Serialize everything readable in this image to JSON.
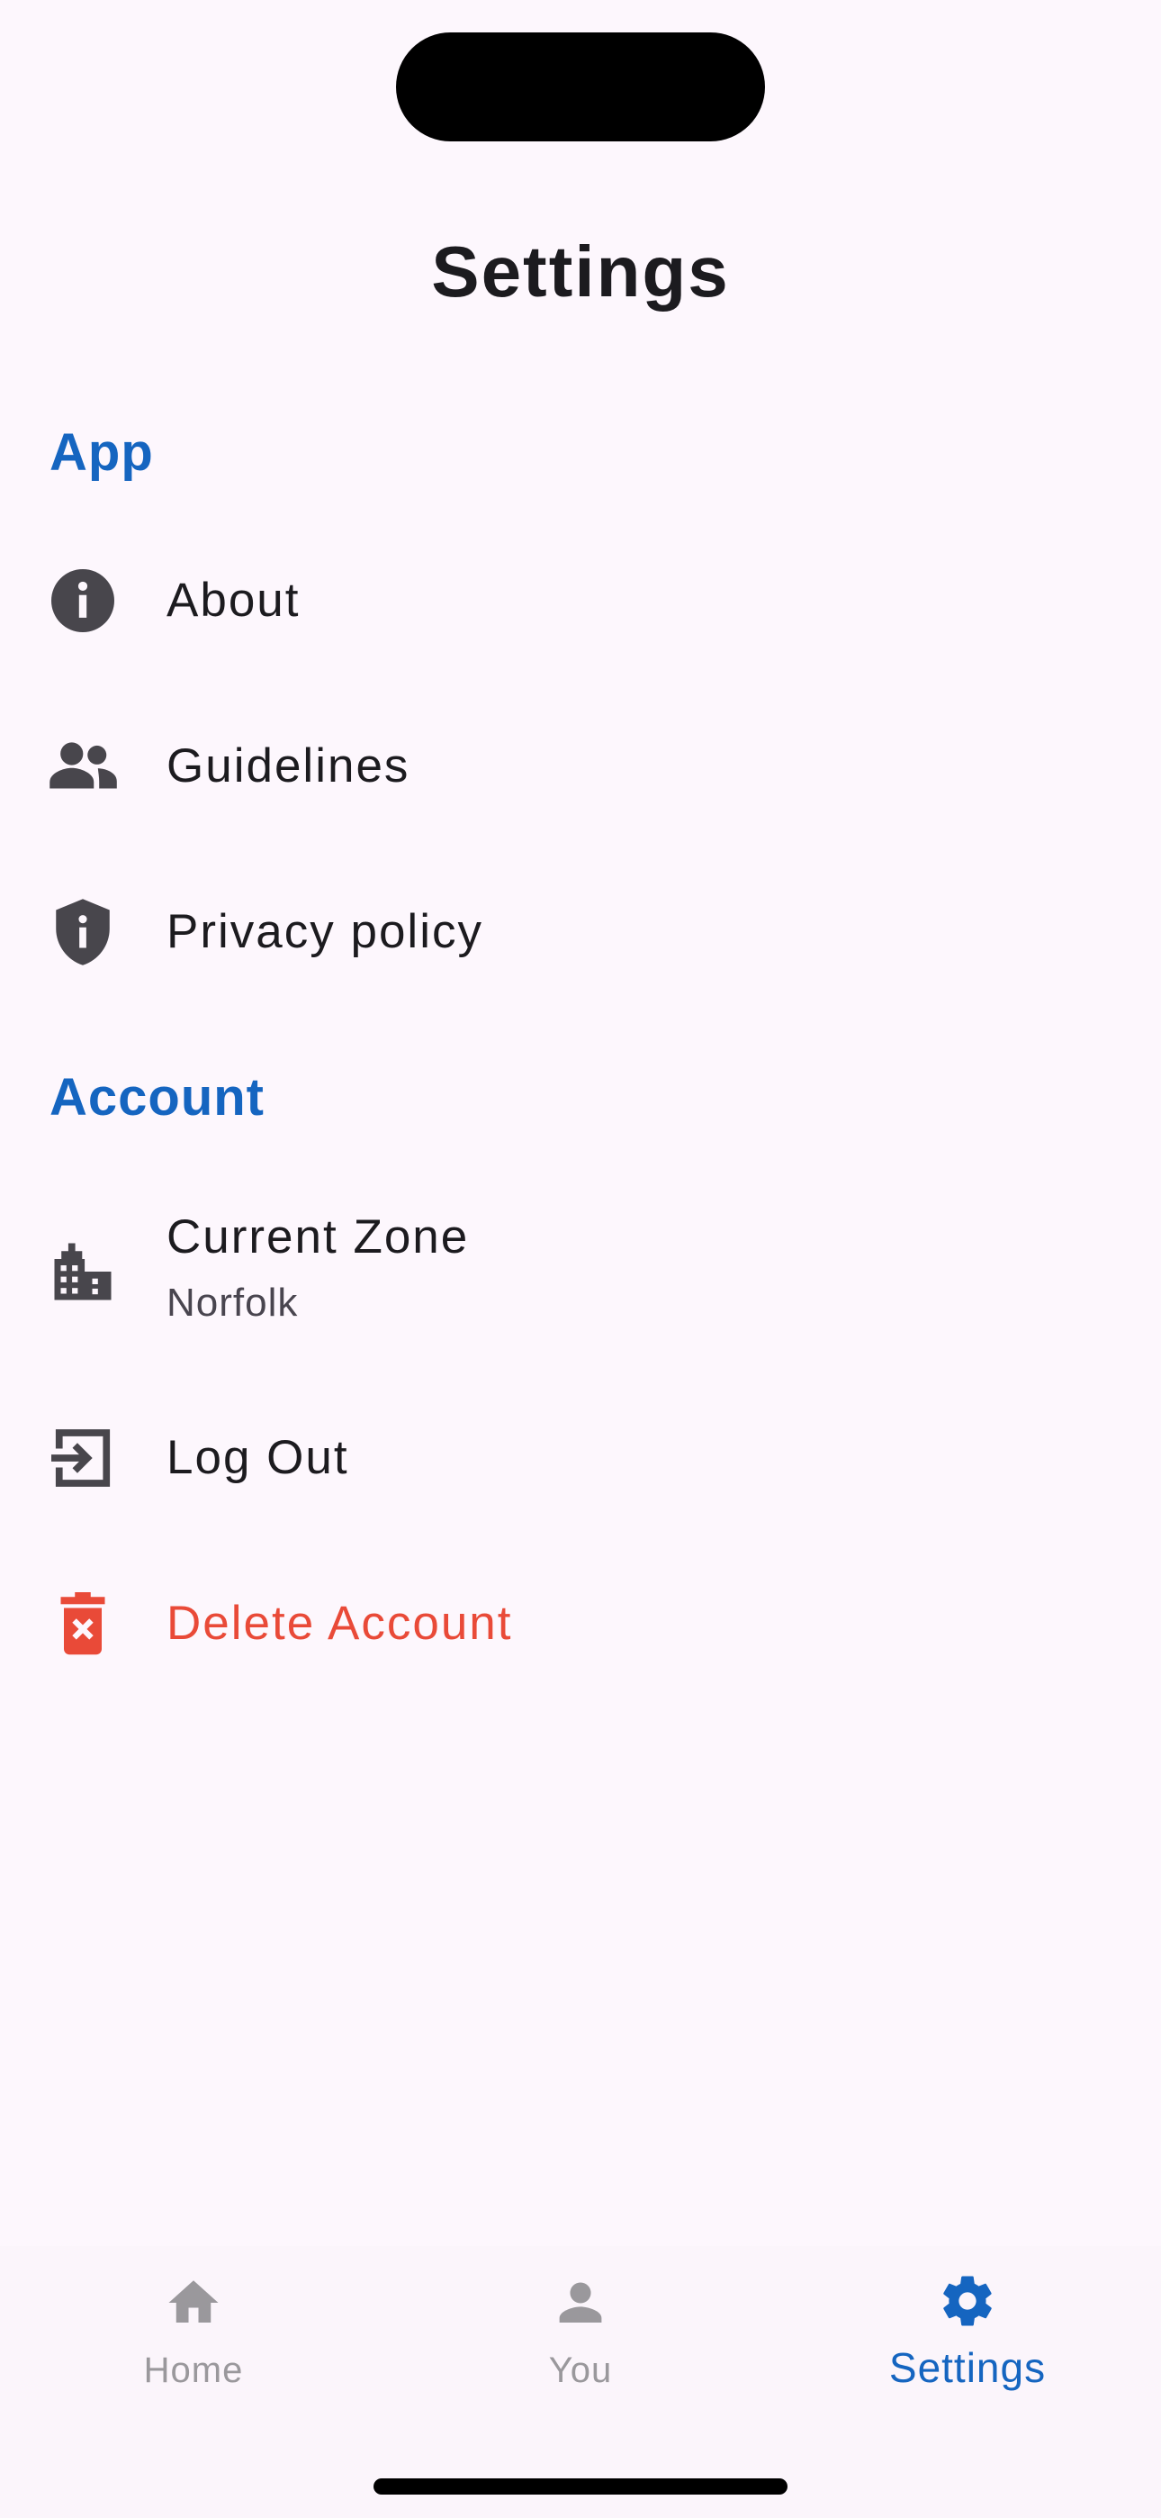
{
  "page": {
    "title": "Settings"
  },
  "colors": {
    "background": "#fdf7fd",
    "section_header": "#1565c0",
    "icon": "#48464c",
    "danger": "#e94a38",
    "nav_active": "#1565c0",
    "nav_inactive": "#9a989c"
  },
  "sections": [
    {
      "header": "App",
      "items": [
        {
          "label": "About",
          "icon": "info-icon"
        },
        {
          "label": "Guidelines",
          "icon": "people-icon"
        },
        {
          "label": "Privacy policy",
          "icon": "shield-info-icon"
        }
      ]
    },
    {
      "header": "Account",
      "items": [
        {
          "label": "Current Zone",
          "value": "Norfolk",
          "icon": "city-icon"
        },
        {
          "label": "Log Out",
          "icon": "logout-icon"
        },
        {
          "label": "Delete Account",
          "icon": "trash-x-icon",
          "danger": true
        }
      ]
    }
  ],
  "bottom_nav": {
    "items": [
      {
        "label": "Home",
        "icon": "home-icon",
        "active": false
      },
      {
        "label": "You",
        "icon": "person-icon",
        "active": false
      },
      {
        "label": "Settings",
        "icon": "gear-icon",
        "active": true
      }
    ]
  }
}
